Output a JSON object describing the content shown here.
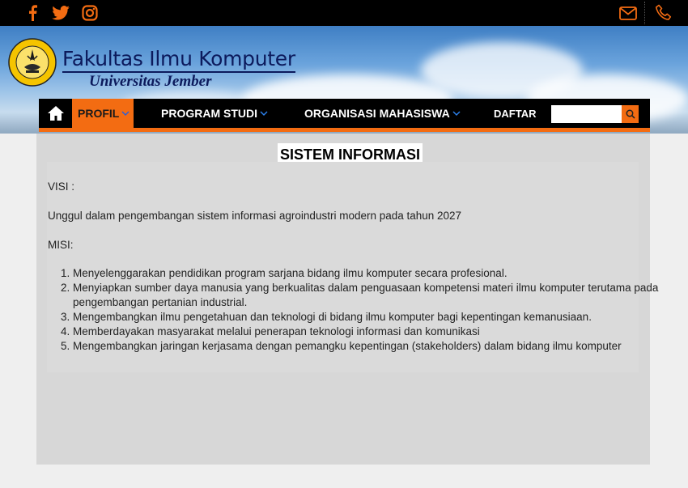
{
  "topbar": {
    "social_icons": [
      "facebook-icon",
      "twitter-icon",
      "instagram-icon"
    ],
    "contact_icons": [
      "mail-icon",
      "phone-icon"
    ]
  },
  "header": {
    "logo_text": "UNIVERSITAS JEMBER",
    "title": "Fakultas Ilmu Komputer",
    "subtitle": "Universitas Jember"
  },
  "nav": {
    "home_icon": "home-icon",
    "items": [
      {
        "label": "PROFIL",
        "has_dropdown": true,
        "active": true
      },
      {
        "label": "PROGRAM STUDI",
        "has_dropdown": true,
        "active": false
      },
      {
        "label": "ORGANISASI MAHASISWA",
        "has_dropdown": true,
        "active": false
      },
      {
        "label": "DAFTAR",
        "has_dropdown": false,
        "active": false
      }
    ],
    "search_value": "",
    "search_icon": "search-icon"
  },
  "main": {
    "title": "SISTEM INFORMASI",
    "visi_label": "VISI :",
    "visi_text": "Unggul dalam pengembangan sistem informasi agroindustri modern pada tahun 2027",
    "misi_label": "MISI:",
    "misi_items": [
      "Menyelenggarakan pendidikan program sarjana bidang ilmu komputer secara profesional.",
      "Menyiapkan sumber daya manusia yang berkualitas dalam penguasaan kompetensi materi ilmu komputer terutama pada pengembangan pertanian industrial.",
      "Mengembangkan ilmu pengetahuan dan teknologi di bidang ilmu komputer bagi kepentingan kemanusiaan.",
      "Memberdayakan masyarakat melalui penerapan teknologi informasi dan komunikasi",
      "Mengembangkan jaringan kerjasama dengan pemangku kepentingan (stakeholders) dalam bidang ilmu komputer"
    ]
  },
  "colors": {
    "accent": "#f36c12",
    "topbar": "#000000",
    "title_blue": "#0c1a5c"
  }
}
